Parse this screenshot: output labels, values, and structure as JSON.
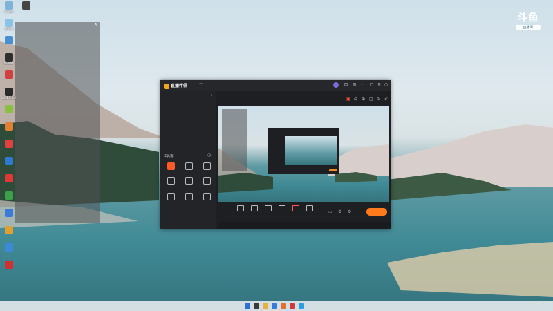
{
  "desktop": {
    "icons": [
      {
        "label": "回收站",
        "color": "#7fb2d8"
      },
      {
        "label": "此电脑",
        "color": "#8cc4e8"
      },
      {
        "label": "",
        "color": "#4a8fd0"
      },
      {
        "label": "NVIDIA",
        "color": "#2e2e2e"
      },
      {
        "label": "",
        "color": "#d04040"
      },
      {
        "label": "OBS Studio",
        "color": "#2a2a2a"
      },
      {
        "label": "",
        "color": "#88c040"
      },
      {
        "label": "",
        "color": "#e08030"
      },
      {
        "label": "",
        "color": "#e04040"
      },
      {
        "label": "",
        "color": "#2f7ad0"
      },
      {
        "label": "",
        "color": "#e03838"
      },
      {
        "label": "",
        "color": "#3aa04a"
      },
      {
        "label": "",
        "color": "#3a7ad8"
      },
      {
        "label": "",
        "color": "#e0a030"
      },
      {
        "label": "",
        "color": "#3a8ad8"
      },
      {
        "label": "",
        "color": "#d03030"
      }
    ],
    "top_icon_label": "",
    "ghost_window_title": "",
    "ghost_close": "✕"
  },
  "watermark": {
    "big": "斗鱼",
    "pill": "直播号",
    "sub": ""
  },
  "window": {
    "app_name": "直播伴侣",
    "version_badge": "",
    "controls": [
      "○",
      "⊡",
      "⊟",
      "─",
      "□",
      "✕"
    ],
    "tabs": [
      "",
      "",
      ""
    ],
    "sources": [
      "",
      ""
    ],
    "tools_title": "工具箱",
    "tools": [
      {
        "label": "",
        "hot": true
      },
      {
        "label": "",
        "hot": false
      },
      {
        "label": "",
        "hot": false
      },
      {
        "label": "",
        "hot": false
      },
      {
        "label": "",
        "hot": false
      },
      {
        "label": "",
        "hot": false
      },
      {
        "label": "",
        "hot": false
      },
      {
        "label": "",
        "hot": false
      },
      {
        "label": "",
        "hot": false
      }
    ],
    "sidebar_bottom": "",
    "room_title": "",
    "tag_buttons": [
      "",
      "",
      ""
    ],
    "stats": "",
    "header_icons": [
      "▣",
      "⊖",
      "⊕",
      "▢",
      "⊘",
      "<"
    ],
    "toolbar": [
      {
        "label": ""
      },
      {
        "label": ""
      },
      {
        "label": ""
      },
      {
        "label": ""
      },
      {
        "label": ""
      },
      {
        "label": ""
      }
    ],
    "live_button": "",
    "status_right": ""
  },
  "taskbar": {
    "center_icons": [
      "#2d6fd6",
      "#3a3a3a",
      "#e8b040",
      "#3a7ad8",
      "#e07030",
      "#d03a3a",
      "#2aa0e0"
    ],
    "tray_text": ""
  }
}
